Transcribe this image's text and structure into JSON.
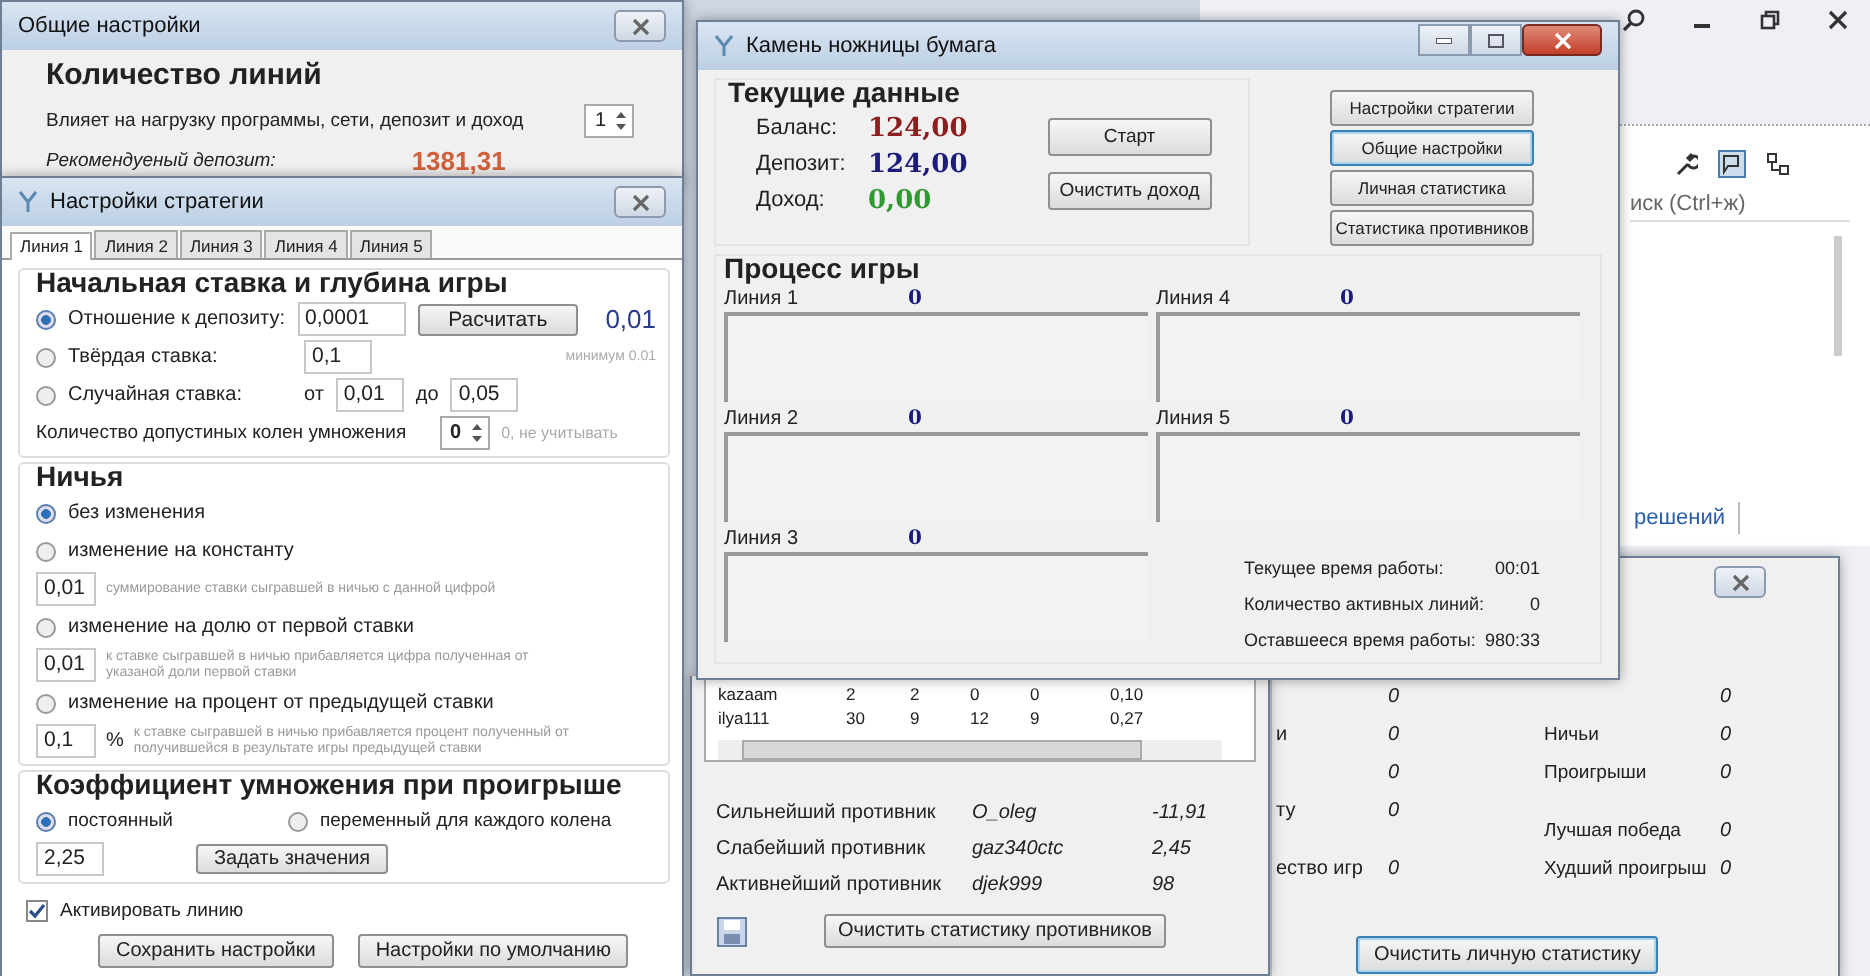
{
  "ide": {
    "search_placeholder": "иск (Ctrl+ж)",
    "tab": "решений"
  },
  "general_settings": {
    "title": "Общие настройки",
    "heading": "Количество линий",
    "description": "Влияет на нагрузку программы, сети, депозит и доход",
    "lines_count": "1",
    "deposit_label": "Рекомендуеный депозит:",
    "deposit_value": "1381,31"
  },
  "strategy": {
    "title": "Настройки стратегии",
    "tabs": [
      {
        "label": "Линия 1",
        "selected": true
      },
      {
        "label": "Линия 2",
        "selected": false
      },
      {
        "label": "Линия 3",
        "selected": false
      },
      {
        "label": "Линия 4",
        "selected": false
      },
      {
        "label": "Линия 5",
        "selected": false
      }
    ],
    "bet_section": {
      "heading": "Начальная ставка и глубина игры",
      "options": [
        {
          "label": "Отношение к депозиту:",
          "selected": true,
          "value": "0,0001"
        },
        {
          "label": "Твёрдая ставка:",
          "selected": false,
          "value": "0,1"
        },
        {
          "label": "Случайная ставка:",
          "selected": false,
          "from_label": "от",
          "from": "0,01",
          "to_label": "до",
          "to": "0,05"
        }
      ],
      "calc_button": "Расчитать",
      "result": "0,01",
      "minimum": "минимум 0.01",
      "depth_label": "Количество допустиных колен умножения",
      "depth": "0",
      "depth_hint": "0, не учитывать"
    },
    "draw_section": {
      "heading": "Ничья",
      "options": [
        {
          "label": "без изменения",
          "selected": true
        },
        {
          "label": "изменение на константу",
          "selected": false,
          "value": "0,01",
          "hint": "суммирование ставки сыгравшей в ничью с данной цифрой"
        },
        {
          "label": "изменение на долю от первой ставки",
          "selected": false,
          "value": "0,01",
          "hint": "к ставке сыгравшей в ничью прибавляется цифра полученная от указаной доли первой ставки"
        },
        {
          "label": "изменение на процент от предыдущей ставки",
          "selected": false,
          "value": "0,1",
          "unit": "%",
          "hint": "к ставке сыгравшей в ничью прибавляется процент полученный от получившейся в результате игры предыдущей ставки"
        }
      ]
    },
    "multiplier_section": {
      "heading": "Коэффициент умножения при проигрыше",
      "options": [
        {
          "label": "постоянный",
          "selected": true
        },
        {
          "label": "переменный для каждого колена",
          "selected": false
        }
      ],
      "value": "2,25",
      "set_button": "Задать значения"
    },
    "activate": {
      "label": "Активировать линию",
      "checked": true
    },
    "buttons": [
      "Сохранить настройки",
      "Настройки по умолчанию"
    ]
  },
  "main": {
    "title": "Камень ножницы бумага",
    "current_heading": "Текущие данные",
    "stats": [
      {
        "label": "Баланс:",
        "value": "124,00",
        "color": "#8b1e1e"
      },
      {
        "label": "Депозит:",
        "value": "124,00",
        "color": "#1c1c7a"
      },
      {
        "label": "Доход:",
        "value": "0,00",
        "color": "#2f9a2f"
      }
    ],
    "start_button": "Старт",
    "clear_button": "Очистить доход",
    "nav_buttons": [
      {
        "label": "Настройки стратегии",
        "selected": false
      },
      {
        "label": "Общие настройки",
        "selected": true
      },
      {
        "label": "Личная статистика",
        "selected": false
      },
      {
        "label": "Статистика противников",
        "selected": false
      }
    ],
    "process_heading": "Процесс игры",
    "lines": [
      {
        "label": "Линия 1",
        "count": "0"
      },
      {
        "label": "Линия 4",
        "count": "0"
      },
      {
        "label": "Линия 2",
        "count": "0"
      },
      {
        "label": "Линия 5",
        "count": "0"
      },
      {
        "label": "Линия 3",
        "count": "0"
      }
    ],
    "timers": [
      {
        "label": "Текущее время работы:",
        "value": "00:01"
      },
      {
        "label": "Количество активных линий:",
        "value": "0"
      },
      {
        "label": "Оставшееся время работы:",
        "value": "980:33"
      }
    ]
  },
  "opponents": {
    "rows": [
      [
        "kazaam",
        "2",
        "2",
        "0",
        "0",
        "0,10"
      ],
      [
        "ilya111",
        "30",
        "9",
        "12",
        "9",
        "0,27"
      ]
    ],
    "summary": [
      {
        "label": "Сильнейший противник",
        "name": "O_oleg",
        "value": "-11,91"
      },
      {
        "label": "Слабейший противник",
        "name": "gaz340ctc",
        "value": "2,45"
      },
      {
        "label": "Активнейший противник",
        "name": "djek999",
        "value": "98"
      }
    ],
    "clear_button": "Очистить статистику противников"
  },
  "personal": {
    "left": [
      {
        "value": "0"
      },
      {
        "label": "и",
        "value": "0"
      },
      {
        "value": "0"
      },
      {
        "label": "ту",
        "value": "0"
      },
      {
        "label": "ество игр",
        "value": "0"
      }
    ],
    "right": [
      {
        "value": "0"
      },
      {
        "label": "Ничьи",
        "value": "0"
      },
      {
        "label": "Проигрыши",
        "value": "0"
      },
      {
        "label": "Лучшая победа",
        "value": "0"
      },
      {
        "label": "Худший проигрыш",
        "value": "0"
      }
    ],
    "clear_button": "Очистить личную статистику"
  }
}
